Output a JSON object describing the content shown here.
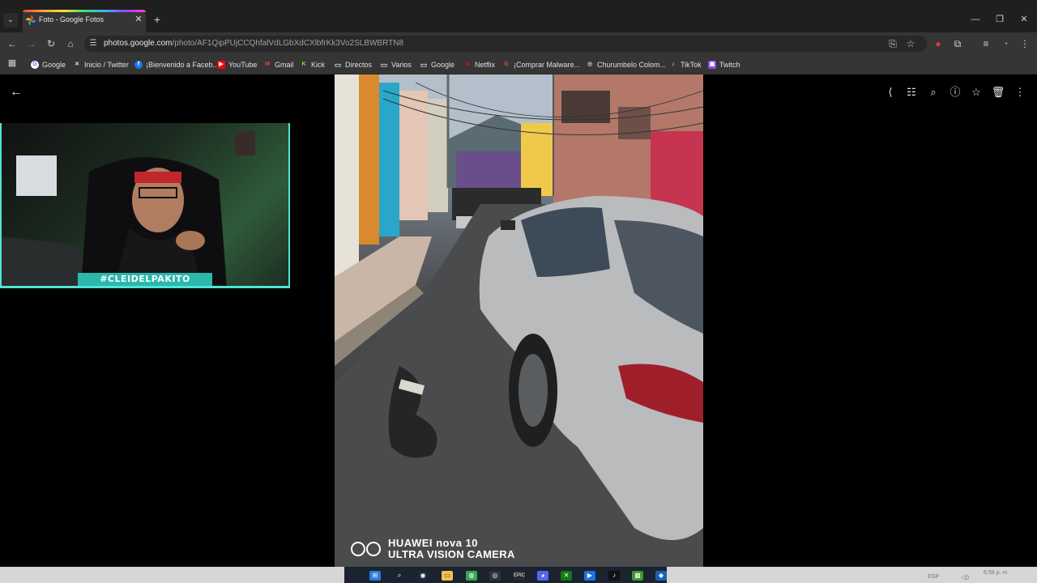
{
  "browser": {
    "tab_title": "Foto - Google Fotos",
    "url_host": "photos.google.com",
    "url_path": "/photo/AF1QipPUjCCQhfalVdLGbXdCXlbfrKk3Vo2SLBWBRTN8"
  },
  "bookmarks": [
    {
      "label": "Google",
      "icon": "google-icon",
      "color": "#4285f4"
    },
    {
      "label": "Inicio / Twitter",
      "icon": "x-icon",
      "color": "#000000"
    },
    {
      "label": "¡Bienvenido a Faceb...",
      "icon": "facebook-icon",
      "color": "#1877f2"
    },
    {
      "label": "YouTube",
      "icon": "youtube-icon",
      "color": "#ff0000"
    },
    {
      "label": "Gmail",
      "icon": "gmail-icon",
      "color": "#ea4335"
    },
    {
      "label": "Kick",
      "icon": "kick-icon",
      "color": "#53fc18"
    },
    {
      "label": "Directos",
      "icon": "folder-icon",
      "color": "#cfcfcf"
    },
    {
      "label": "Varios",
      "icon": "folder-icon",
      "color": "#cfcfcf"
    },
    {
      "label": "Google",
      "icon": "folder-icon",
      "color": "#cfcfcf"
    },
    {
      "label": "Netflix",
      "icon": "netflix-icon",
      "color": "#e50914"
    },
    {
      "label": "¡Comprar Malware...",
      "icon": "g-icon",
      "color": "#e8452c"
    },
    {
      "label": "Churumbelo Colom...",
      "icon": "globe-icon",
      "color": "#cfcfcf"
    },
    {
      "label": "TikTok",
      "icon": "tiktok-icon",
      "color": "#000000"
    },
    {
      "label": "Twitch",
      "icon": "twitch-icon",
      "color": "#9146ff"
    }
  ],
  "webcam": {
    "tag": "#CLEIDELPAKITO",
    "accent": "#4fe3d6"
  },
  "photo": {
    "watermark_brand": "HUAWEI nova 10",
    "watermark_sub": "ULTRA VISION CAMERA"
  },
  "taskbar": {
    "tray_lang": "ESP",
    "tray_time": "6:58 p. m."
  }
}
